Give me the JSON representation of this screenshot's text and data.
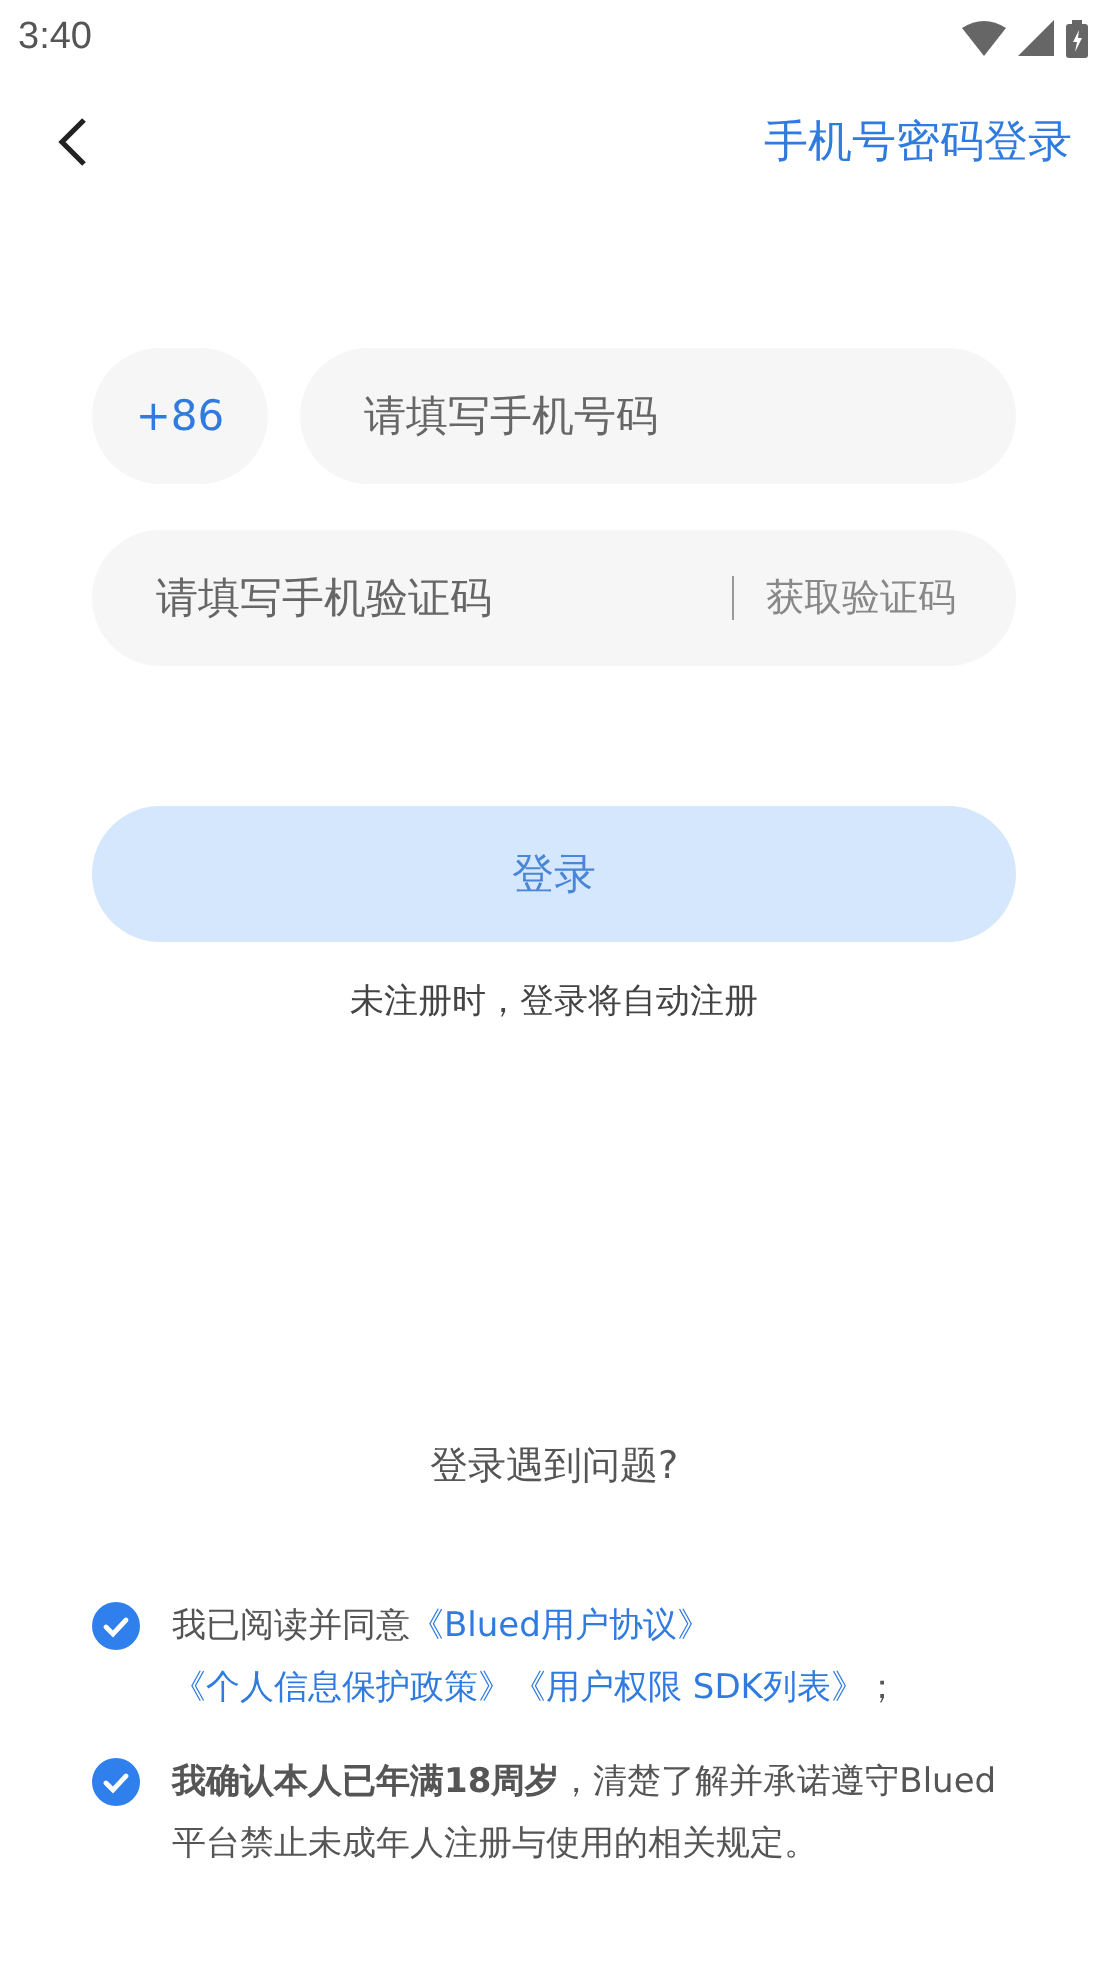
{
  "status_bar": {
    "time": "3:40"
  },
  "header": {
    "switch_mode": "手机号密码登录"
  },
  "phone": {
    "country_code": "+86",
    "placeholder": "请填写手机号码"
  },
  "code": {
    "placeholder": "请填写手机验证码",
    "get_code": "获取验证码"
  },
  "login_button": {
    "label": "登录",
    "disabled": true
  },
  "auto_register_hint": "未注册时，登录将自动注册",
  "trouble_link": "登录遇到问题?",
  "agreements": [
    {
      "checked": true,
      "parts": [
        {
          "kind": "plain",
          "text": "我已阅读并同意"
        },
        {
          "kind": "link",
          "text": "《Blued用户协议》"
        },
        {
          "kind": "link",
          "text": "《个人信息保护政策》"
        },
        {
          "kind": "link",
          "text": "《用户权限 SDK列表》"
        },
        {
          "kind": "plain",
          "text": "；"
        }
      ]
    },
    {
      "checked": true,
      "parts": [
        {
          "kind": "plain",
          "text": "**我确认本人已年满18周岁**，清楚了解并承诺遵守Blued平台禁止未成年人注册与使用的相关规定。"
        }
      ]
    }
  ]
}
